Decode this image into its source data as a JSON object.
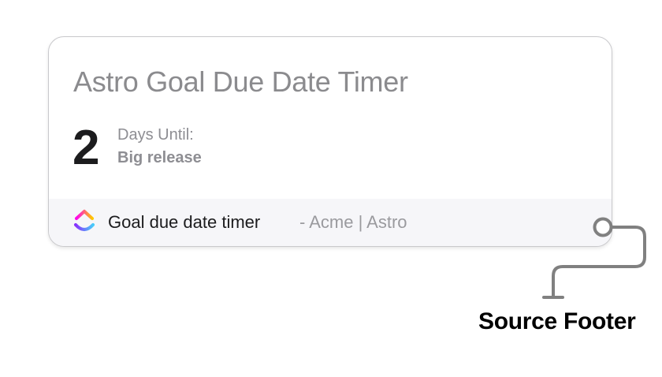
{
  "widget": {
    "title": "Astro Goal Due Date Timer",
    "count": "2",
    "until_label": "Days Until:",
    "goal_name": "Big release"
  },
  "footer": {
    "app_name": "Goal due date timer",
    "source": "- Acme | Astro",
    "logo_icon": "clickup-logo-icon"
  },
  "callout": {
    "label": "Source Footer"
  },
  "colors": {
    "title_text": "#8b8b8e",
    "count_text": "#1c1c1e",
    "footer_background": "#f6f6f9",
    "connector": "#808080"
  }
}
